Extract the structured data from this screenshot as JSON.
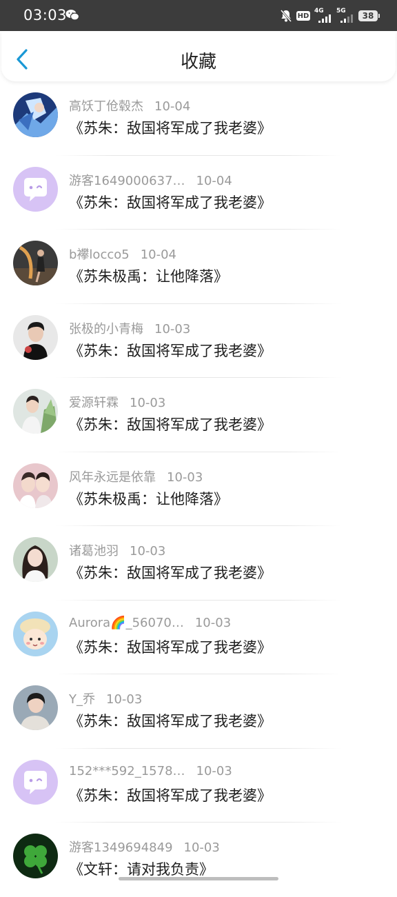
{
  "status_bar": {
    "time": "03:03",
    "network_a": "4G",
    "network_b": "5G",
    "battery": "38",
    "hd_label": "HD"
  },
  "header": {
    "title": "收藏"
  },
  "items": [
    {
      "user": "高饫丁伧毂杰",
      "date": "10-04",
      "book": "《苏朱：敌国将军成了我老婆》",
      "avatar": "anime-warrior"
    },
    {
      "user": "游客1649000637…",
      "date": "10-04",
      "book": "《苏朱：敌国将军成了我老婆》",
      "avatar": "default-chat"
    },
    {
      "user": "b襻locco5",
      "date": "10-04",
      "book": "《苏朱极禹：让他降落》",
      "avatar": "dancer"
    },
    {
      "user": "张极的小青梅",
      "date": "10-03",
      "book": "《苏朱：敌国将军成了我老婆》",
      "avatar": "boy-dark"
    },
    {
      "user": "爱源轩霖",
      "date": "10-03",
      "book": "《苏朱：敌国将军成了我老婆》",
      "avatar": "boy-flowers"
    },
    {
      "user": "风年永远是依靠",
      "date": "10-03",
      "book": "《苏朱极禹：让他降落》",
      "avatar": "two-boys"
    },
    {
      "user": "诸葛池羽",
      "date": "10-03",
      "book": "《苏朱：敌国将军成了我老婆》",
      "avatar": "girl"
    },
    {
      "user": "Aurora🌈_56070…",
      "date": "10-03",
      "book": "《苏朱：敌国将军成了我老婆》",
      "avatar": "cartoon-bear"
    },
    {
      "user": "Y_乔",
      "date": "10-03",
      "book": "《苏朱：敌国将军成了我老婆》",
      "avatar": "boy-light"
    },
    {
      "user": "152***592_1578…",
      "date": "10-03",
      "book": "《苏朱：敌国将军成了我老婆》",
      "avatar": "default-chat"
    },
    {
      "user": "游客1349694849",
      "date": "10-03",
      "book": "《文轩：请对我负责》",
      "avatar": "clover"
    }
  ],
  "colors": {
    "accent": "#1a98d5",
    "default_avatar": "#d7c3f5"
  }
}
